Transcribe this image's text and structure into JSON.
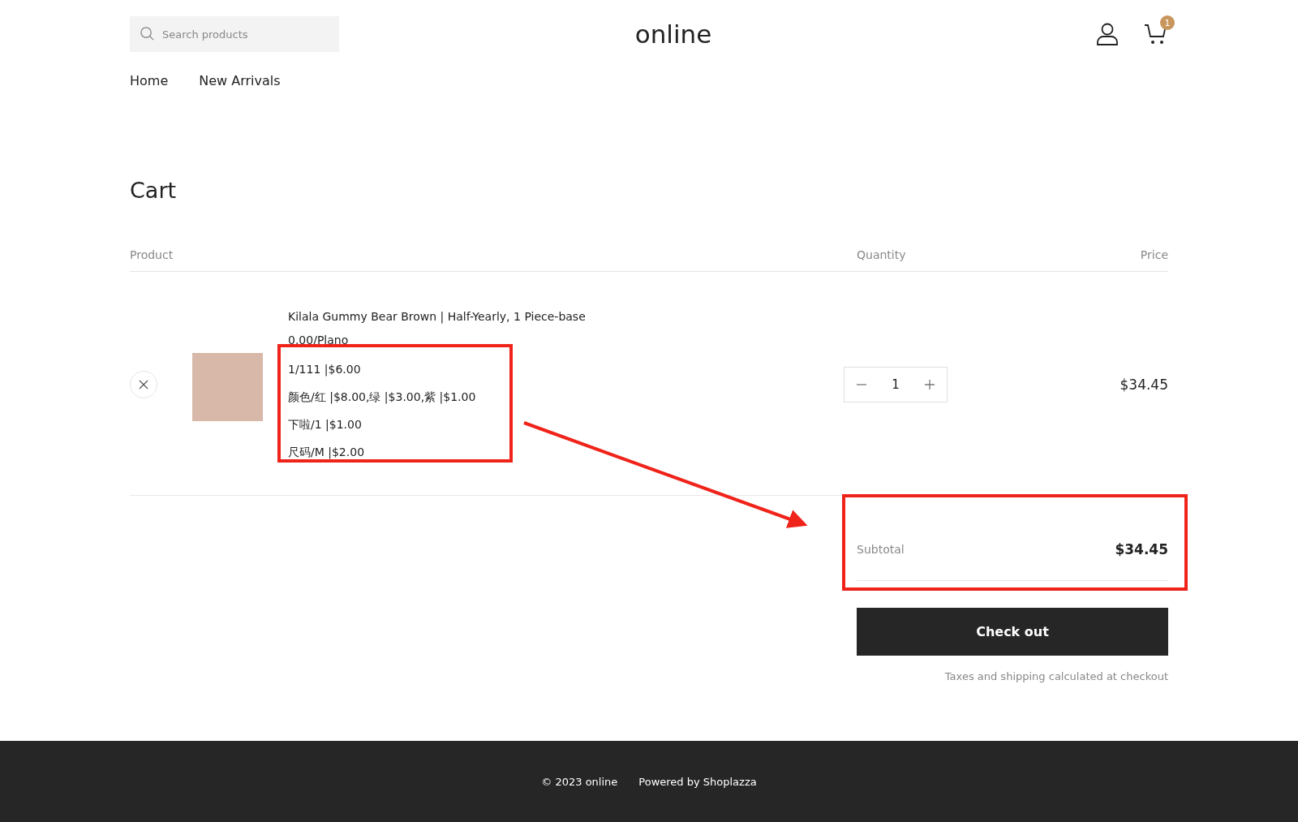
{
  "header": {
    "search": {
      "placeholder": "Search products"
    },
    "logo": "online",
    "cart_count": "1"
  },
  "nav": [
    {
      "label": "Home"
    },
    {
      "label": "New Arrivals"
    }
  ],
  "title": "Cart",
  "columns": [
    "Product",
    "Quantity",
    "Price"
  ],
  "items": [
    {
      "name": "Kilala Gummy Bear Brown | Half-Yearly, 1 Piece-base",
      "options": [
        "0.00/Plano",
        "1/111 |$6.00",
        "颜色/红 |$8.00,绿 |$3.00,紫 |$1.00",
        "下啦/1 |$1.00",
        "尺码/M |$2.00"
      ],
      "quantity": "1",
      "price": "$34.45"
    }
  ],
  "summary": {
    "subtotal_label": "Subtotal",
    "subtotal": "$34.45",
    "checkout": "Check out",
    "note": "Taxes and shipping calculated at checkout"
  },
  "footer": [
    "© 2023 online",
    "Powered by Shoplazza"
  ]
}
